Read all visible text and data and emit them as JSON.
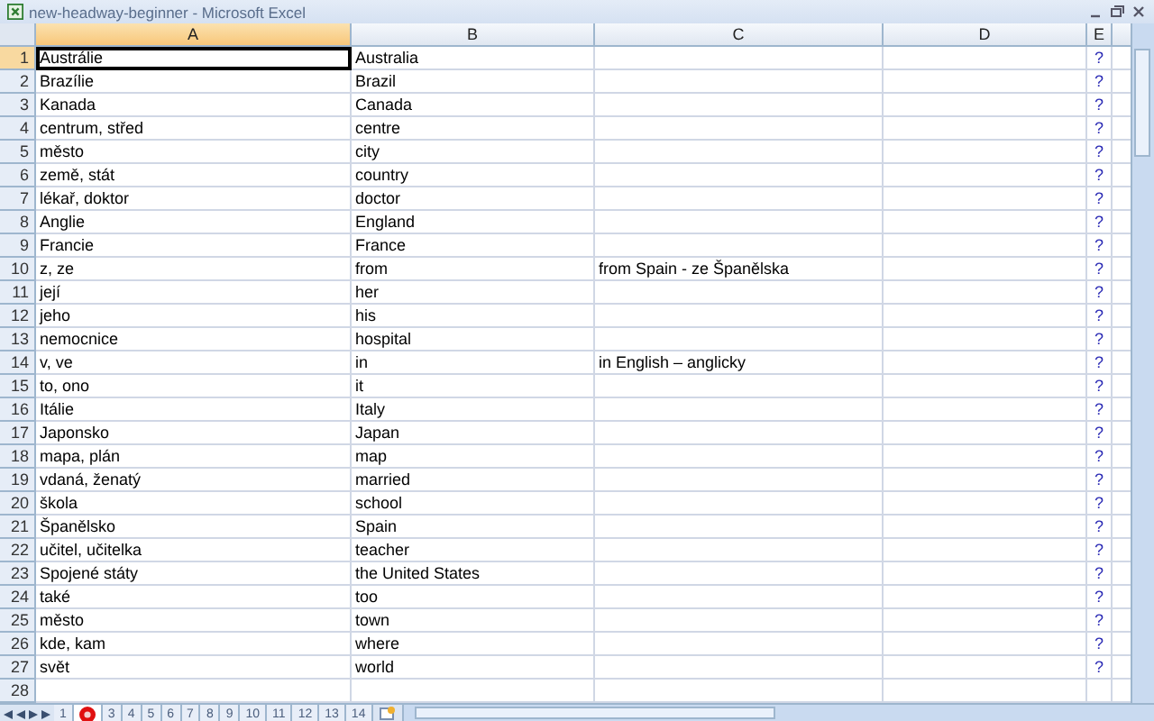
{
  "window": {
    "title": "new-headway-beginner - Microsoft Excel"
  },
  "columns": [
    {
      "label": "A",
      "selected": true
    },
    {
      "label": "B",
      "selected": false
    },
    {
      "label": "C",
      "selected": false
    },
    {
      "label": "D",
      "selected": false
    },
    {
      "label": "E",
      "selected": false
    }
  ],
  "rows": [
    {
      "number": "1",
      "selected": true,
      "a": "Austrálie",
      "b": "Australia",
      "e": "?"
    },
    {
      "number": "2",
      "selected": false,
      "a": "Brazílie",
      "b": "Brazil",
      "e": "?"
    },
    {
      "number": "3",
      "selected": false,
      "a": "Kanada",
      "b": "Canada",
      "e": "?"
    },
    {
      "number": "4",
      "selected": false,
      "a": "centrum, střed",
      "b": "centre",
      "e": "?"
    },
    {
      "number": "5",
      "selected": false,
      "a": "město",
      "b": "city",
      "e": "?"
    },
    {
      "number": "6",
      "selected": false,
      "a": "země, stát",
      "b": "country",
      "e": "?"
    },
    {
      "number": "7",
      "selected": false,
      "a": "lékař, doktor",
      "b": "doctor",
      "e": "?"
    },
    {
      "number": "8",
      "selected": false,
      "a": "Anglie",
      "b": "England",
      "e": "?"
    },
    {
      "number": "9",
      "selected": false,
      "a": "Francie",
      "b": "France",
      "e": "?"
    },
    {
      "number": "10",
      "selected": false,
      "a": "z, ze",
      "b": "from",
      "c": "from Spain - ze Španělska",
      "e": "?"
    },
    {
      "number": "11",
      "selected": false,
      "a": "její",
      "b": "her",
      "e": "?"
    },
    {
      "number": "12",
      "selected": false,
      "a": "jeho",
      "b": "his",
      "e": "?"
    },
    {
      "number": "13",
      "selected": false,
      "a": "nemocnice",
      "b": "hospital",
      "e": "?"
    },
    {
      "number": "14",
      "selected": false,
      "a": "v, ve",
      "b": "in",
      "c": "in English – anglicky",
      "e": "?"
    },
    {
      "number": "15",
      "selected": false,
      "a": "to, ono",
      "b": "it",
      "e": "?"
    },
    {
      "number": "16",
      "selected": false,
      "a": "Itálie",
      "b": "Italy",
      "e": "?"
    },
    {
      "number": "17",
      "selected": false,
      "a": "Japonsko",
      "b": "Japan",
      "e": "?"
    },
    {
      "number": "18",
      "selected": false,
      "a": "mapa, plán",
      "b": "map",
      "e": "?"
    },
    {
      "number": "19",
      "selected": false,
      "a": "vdaná, ženatý",
      "b": "married",
      "e": "?"
    },
    {
      "number": "20",
      "selected": false,
      "a": "škola",
      "b": "school",
      "e": "?"
    },
    {
      "number": "21",
      "selected": false,
      "a": "Španělsko",
      "b": "Spain",
      "e": "?"
    },
    {
      "number": "22",
      "selected": false,
      "a": "učitel, učitelka",
      "b": "teacher",
      "e": "?"
    },
    {
      "number": "23",
      "selected": false,
      "a": "Spojené státy",
      "b": "the United States",
      "e": "?"
    },
    {
      "number": "24",
      "selected": false,
      "a": "také",
      "b": "too",
      "e": "?"
    },
    {
      "number": "25",
      "selected": false,
      "a": "město",
      "b": "town",
      "e": "?"
    },
    {
      "number": "26",
      "selected": false,
      "a": "kde, kam",
      "b": "where",
      "e": "?"
    },
    {
      "number": "27",
      "selected": false,
      "a": "svět",
      "b": "world",
      "e": "?"
    },
    {
      "number": "28",
      "selected": false
    }
  ],
  "sheet_tabs": [
    {
      "label": "1",
      "selected": false,
      "marked": false
    },
    {
      "selected": true,
      "marked": true
    },
    {
      "label": "3",
      "selected": false,
      "marked": false
    },
    {
      "label": "4",
      "selected": false,
      "marked": false
    },
    {
      "label": "5",
      "selected": false,
      "marked": false
    },
    {
      "label": "6",
      "selected": false,
      "marked": false
    },
    {
      "label": "7",
      "selected": false,
      "marked": false
    },
    {
      "label": "8",
      "selected": false,
      "marked": false
    },
    {
      "label": "9",
      "selected": false,
      "marked": false
    },
    {
      "label": "10",
      "selected": false,
      "marked": false
    },
    {
      "label": "11",
      "selected": false,
      "marked": false
    },
    {
      "label": "12",
      "selected": false,
      "marked": false
    },
    {
      "label": "13",
      "selected": false,
      "marked": false
    },
    {
      "label": "14",
      "selected": false,
      "marked": false
    }
  ]
}
